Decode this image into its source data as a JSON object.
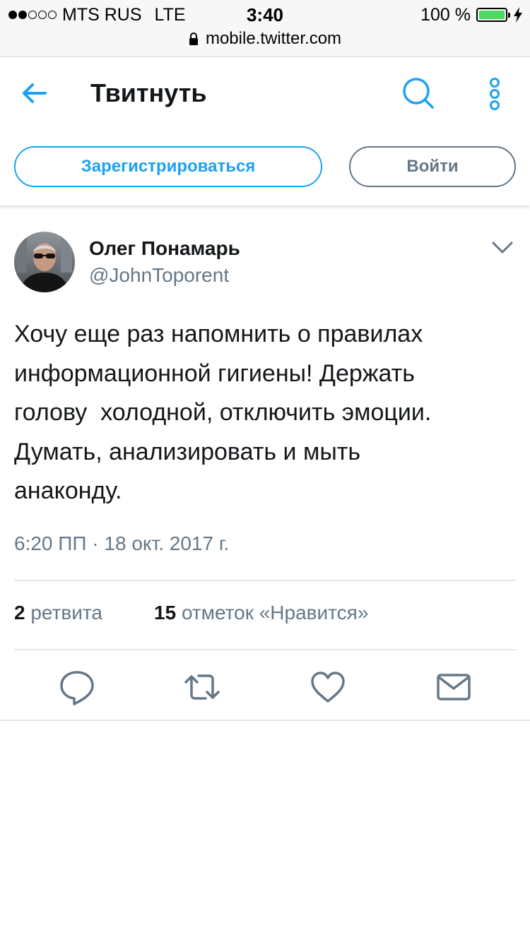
{
  "status_bar": {
    "carrier": "MTS RUS",
    "network": "LTE",
    "time": "3:40",
    "battery_percent": "100 %",
    "battery_level": 1.0,
    "signal_bars_filled": 2,
    "signal_bars_total": 5
  },
  "browser": {
    "url": "mobile.twitter.com"
  },
  "header": {
    "title": "Твитнуть"
  },
  "auth": {
    "signup_label": "Зарегистрироваться",
    "login_label": "Войти"
  },
  "tweet": {
    "author_name": "Олег Понамарь",
    "author_handle": "@JohnToporent",
    "text": "Хочу еще раз напомнить о правилах\nинформационной гигиены! Держать\nголову  холодной, отключить эмоции.\nДумать, анализировать и мыть\nанаконду.",
    "timestamp": "6:20 ПП · 18 окт. 2017 г.",
    "retweets_count": "2",
    "retweets_label": "ретвита",
    "likes_count": "15",
    "likes_label": "отметок «Нравится»"
  },
  "icons": {
    "back": "arrow-left-icon",
    "search": "search-icon",
    "more": "more-vertical-icon",
    "caret": "chevron-down-icon",
    "reply": "reply-icon",
    "retweet": "retweet-icon",
    "like": "heart-icon",
    "message": "envelope-icon",
    "lock": "lock-icon"
  },
  "colors": {
    "accent": "#1da1f2",
    "secondary_text": "#657786",
    "primary_text": "#14171a",
    "divider": "#e1e8ed",
    "battery": "#4cd964"
  }
}
